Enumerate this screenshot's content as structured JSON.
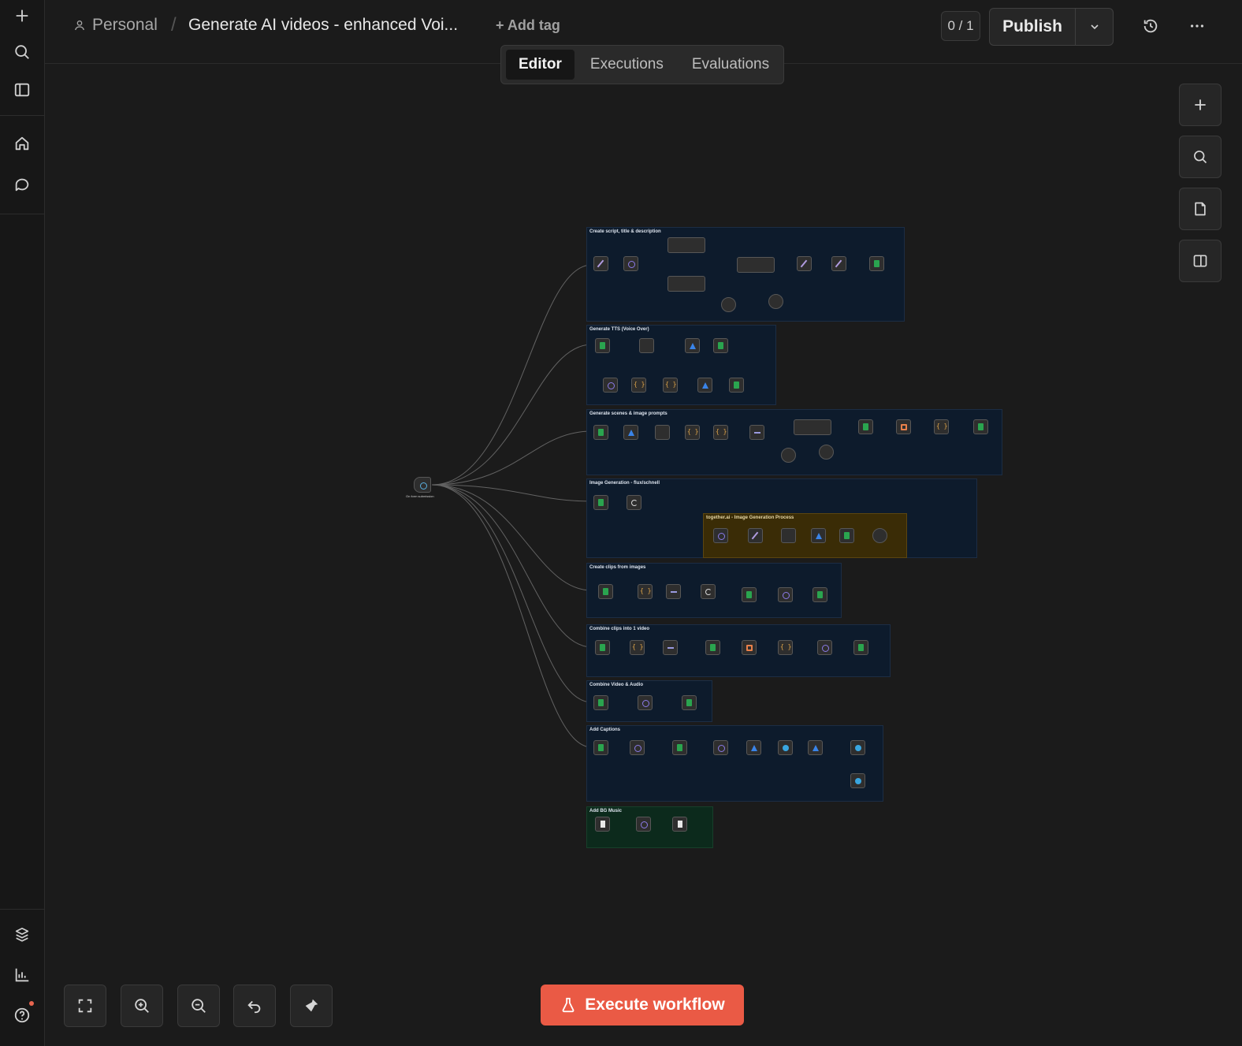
{
  "header": {
    "project": "Personal",
    "workflow_name": "Generate AI videos - enhanced Voi...",
    "add_tag": "+ Add tag",
    "counter": "0 / 1",
    "publish": "Publish"
  },
  "tabs": [
    "Editor",
    "Executions",
    "Evaluations"
  ],
  "active_tab": "Editor",
  "execute_label": "Execute workflow",
  "canvas": {
    "trigger": "On form submission",
    "groups": [
      "Create script, title & description",
      "Generate TTS (Voice Over)",
      "Generate scenes & image prompts",
      "Image Generation - flux/schnell",
      "together.ai - Image Generation Process",
      "Create clips from images",
      "Combine clips into 1 video",
      "Combine Video & Audio",
      "Add Captions",
      "Add BG Music"
    ]
  },
  "colors": {
    "accent": "#ea5a45",
    "canvas_bg": "#1b1b1b",
    "group_bg": "#0d1b2c",
    "group_amber": "#3a2c06",
    "group_green": "#0c2a1c"
  },
  "icons": {
    "rail": [
      "plus-icon",
      "search-icon",
      "sidebar-icon",
      "home-icon",
      "chat-icon",
      "templates-icon",
      "insights-icon",
      "help-icon"
    ],
    "canvas_tools": [
      "plus-icon",
      "search-icon",
      "sticky-note-icon",
      "panel-icon"
    ],
    "bottom_tools": [
      "fit-view-icon",
      "zoom-in-icon",
      "zoom-out-icon",
      "undo-icon",
      "tidy-up-icon"
    ]
  }
}
